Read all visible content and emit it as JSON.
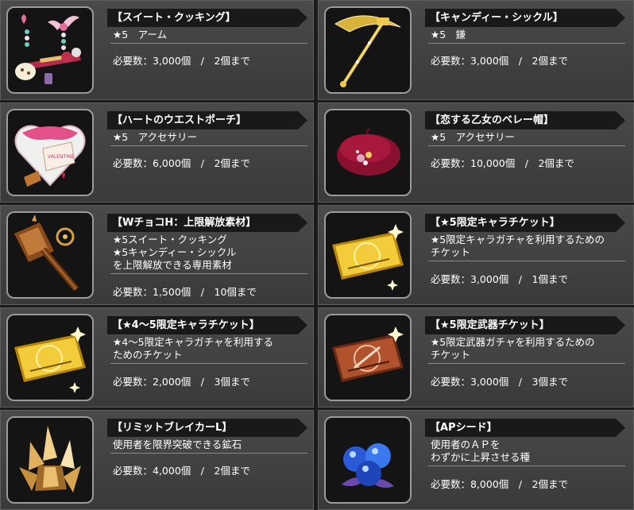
{
  "items": [
    {
      "title": "【スイート・クッキング】",
      "desc": "★5　アーム",
      "req": "必要数：3,000個　/　2個まで",
      "icon": "arm-weapon-icon"
    },
    {
      "title": "【キャンディー・シックル】",
      "desc": "★5　鎌",
      "req": "必要数：3,000個　/　2個まで",
      "icon": "sickle-icon"
    },
    {
      "title": "【ハートのウエストポーチ】",
      "desc": "★5　アクセサリー",
      "req": "必要数：6,000個　/　2個まで",
      "icon": "heart-pouch-icon"
    },
    {
      "title": "【恋する乙女のベレー帽】",
      "desc": "★5　アクセサリー",
      "req": "必要数：10,000個　/　2個まで",
      "icon": "beret-icon"
    },
    {
      "title": "【WチョコH：上限解放素材】",
      "desc": "★5スイート・クッキング\n★5キャンディー・シックル\nを上限解放できる専用素材",
      "req": "必要数：1,500個　/　10個まで",
      "icon": "hammer-material-icon"
    },
    {
      "title": "【★5限定キャラチケット】",
      "desc": "★5限定キャラガチャを利用するための\nチケット",
      "req": "必要数：3,000個　/　1個まで",
      "icon": "gold-ticket-icon"
    },
    {
      "title": "【★4～5限定キャラチケット】",
      "desc": "★4～5限定キャラガチャを利用する\nためのチケット",
      "req": "必要数：2,000個　/　3個まで",
      "icon": "gold-ticket-icon"
    },
    {
      "title": "【★5限定武器チケット】",
      "desc": "★5限定武器ガチャを利用するための\nチケット",
      "req": "必要数：3,000個　/　3個まで",
      "icon": "bronze-ticket-icon"
    },
    {
      "title": "【リミットブレイカーL】",
      "desc": "使用者を限界突破できる鉱石",
      "req": "必要数：4,000個　/　2個まで",
      "icon": "crystal-ore-icon"
    },
    {
      "title": "【APシード】",
      "desc": "使用者のＡＰを\nわずかに上昇させる種",
      "req": "必要数：8,000個　/　2個まで",
      "icon": "blue-seed-icon"
    }
  ]
}
